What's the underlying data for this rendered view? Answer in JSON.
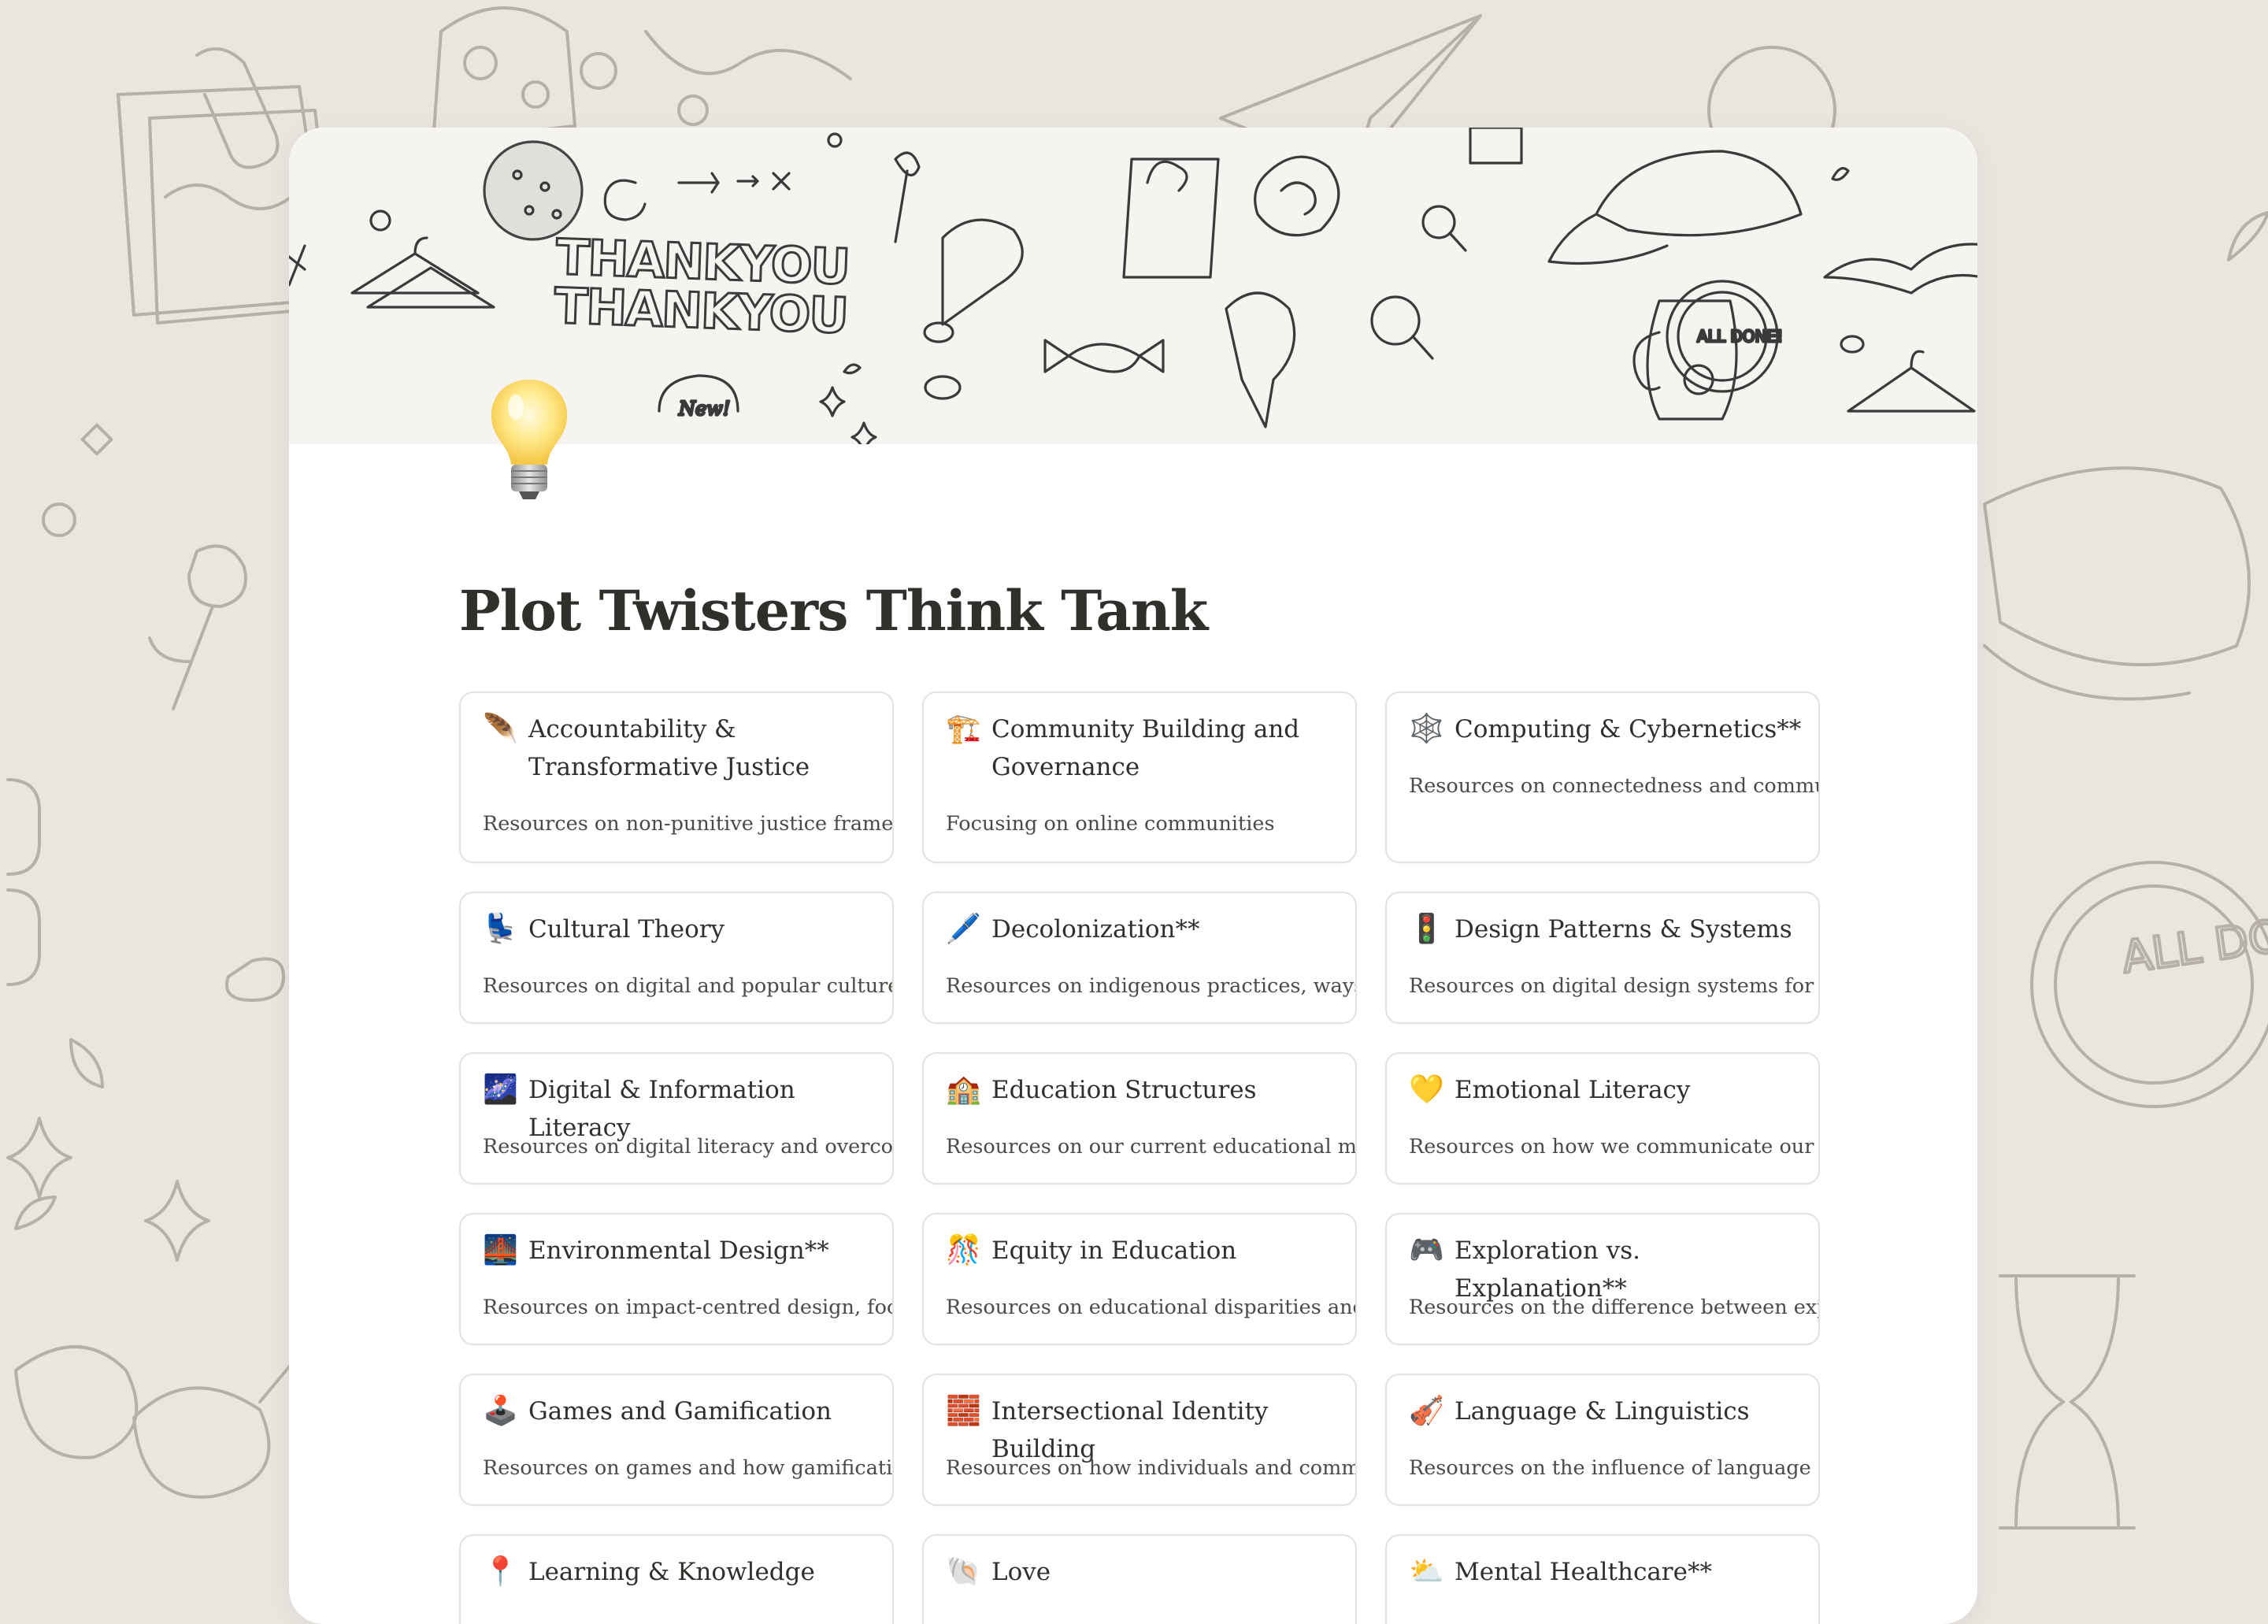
{
  "page": {
    "title": "Plot Twisters Think Tank",
    "icon": "light-bulb-icon"
  },
  "cover": {
    "text_line1": "THANKYOU",
    "text_line2": "THANKYOU",
    "badge_text": "ALL DONE!",
    "new_text": "New!"
  },
  "background": {
    "badge_text": "ALL DONE!"
  },
  "cards": [
    {
      "emoji": "🪶",
      "icon": "feather-icon",
      "title": "Accountability & Transformative Justice",
      "desc": "Resources on non-punitive justice frameworks"
    },
    {
      "emoji": "🏗️",
      "icon": "construction-crane-icon",
      "title": "Community Building and Governance",
      "desc": "Focusing on online communities"
    },
    {
      "emoji": "🕸️",
      "icon": "spider-web-icon",
      "title": "Computing & Cybernetics**",
      "desc": "Resources on connectedness and communication"
    },
    {
      "emoji": "💺",
      "icon": "seat-icon",
      "title": "Cultural Theory",
      "desc": "Resources on digital and popular culture"
    },
    {
      "emoji": "🖊️",
      "icon": "pen-icon",
      "title": "Decolonization**",
      "desc": "Resources on indigenous practices, ways of thinking"
    },
    {
      "emoji": "🚦",
      "icon": "traffic-light-icon",
      "title": "Design Patterns & Systems",
      "desc": "Resources on digital design systems for our digital"
    },
    {
      "emoji": "🌌",
      "icon": "milky-way-icon",
      "title": "Digital & Information Literacy",
      "desc": "Resources on digital literacy and overcoming"
    },
    {
      "emoji": "🏫",
      "icon": "school-icon",
      "title": "Education Structures",
      "desc": "Resources on our current educational methods"
    },
    {
      "emoji": "💛",
      "icon": "yellow-heart-icon",
      "title": "Emotional Literacy",
      "desc": "Resources on how we communicate our emotions"
    },
    {
      "emoji": "🌉",
      "icon": "bridge-icon",
      "title": "Environmental Design**",
      "desc": "Resources on impact-centred design, focusing"
    },
    {
      "emoji": "🎊",
      "icon": "confetti-ball-icon",
      "title": "Equity in Education",
      "desc": "Resources on educational disparities and impact"
    },
    {
      "emoji": "🎮",
      "icon": "game-controller-icon",
      "title": "Exploration vs. Explanation**",
      "desc": "Resources on the difference between exploration"
    },
    {
      "emoji": "🕹️",
      "icon": "joystick-icon",
      "title": "Games and Gamification",
      "desc": "Resources on games and how gamification can"
    },
    {
      "emoji": "🧱",
      "icon": "brick-icon",
      "title": "Intersectional Identity Building",
      "desc": "Resources on how individuals and communities"
    },
    {
      "emoji": "🎻",
      "icon": "violin-icon",
      "title": "Language & Linguistics",
      "desc": "Resources on the influence of language on how"
    },
    {
      "emoji": "📍",
      "icon": "round-pushpin-icon",
      "title": "Learning & Knowledge",
      "desc": ""
    },
    {
      "emoji": "🐚",
      "icon": "spiral-shell-icon",
      "title": "Love",
      "desc": ""
    },
    {
      "emoji": "⛅",
      "icon": "sun-behind-cloud-icon",
      "title": "Mental Healthcare**",
      "desc": ""
    }
  ]
}
